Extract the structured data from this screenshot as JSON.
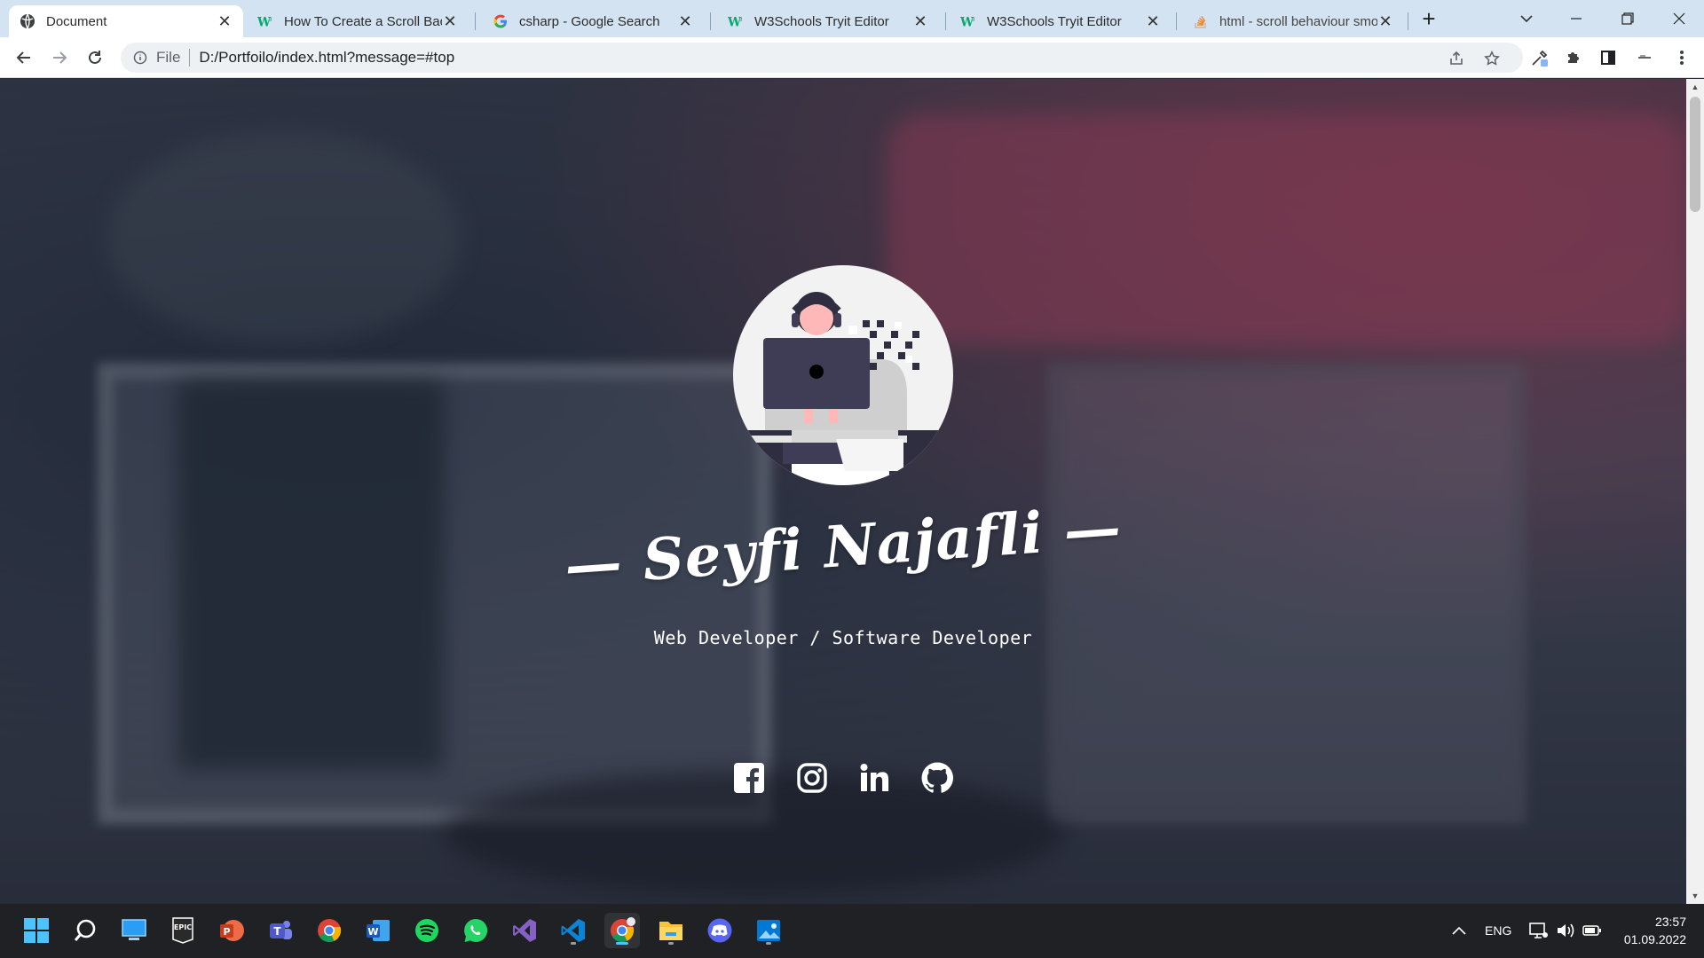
{
  "browser": {
    "tabs": [
      {
        "label": "Document",
        "icon": "globe-icon",
        "active": true
      },
      {
        "label": "How To Create a Scroll Back",
        "icon": "w3schools-icon"
      },
      {
        "label": "csharp - Google Search",
        "icon": "google-icon"
      },
      {
        "label": "W3Schools Tryit Editor",
        "icon": "w3schools-icon"
      },
      {
        "label": "W3Schools Tryit Editor",
        "icon": "w3schools-icon"
      },
      {
        "label": "html - scroll behaviour smo",
        "icon": "stackoverflow-icon"
      }
    ],
    "new_tab": "+",
    "address": {
      "scheme": "File",
      "url": "D:/Portfoilo/index.html?message=#top"
    }
  },
  "hero": {
    "name": "— Seyfi Najafli —",
    "role": "Web Developer / Software Developer",
    "socials": [
      "facebook-icon",
      "instagram-icon",
      "linkedin-icon",
      "github-icon"
    ]
  },
  "taskbar": {
    "apps": [
      "windows-start-icon",
      "search-icon",
      "desktop-icon",
      "epic-games-icon",
      "powerpoint-icon",
      "teams-icon",
      "chrome-icon",
      "word-icon",
      "spotify-icon",
      "whatsapp-icon",
      "visual-studio-icon",
      "vscode-icon",
      "chrome-icon",
      "file-explorer-icon",
      "discord-icon",
      "photos-icon"
    ],
    "language": "ENG",
    "time": "23:57",
    "date": "01.09.2022"
  },
  "colors": {
    "tabstrip": "#d3e3f1",
    "accent": "#4cc2ff",
    "taskbar": "#1f2124"
  }
}
